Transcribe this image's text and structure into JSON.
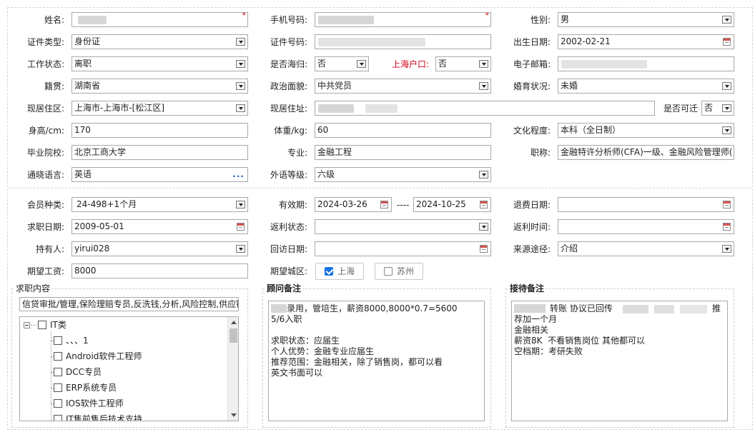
{
  "form": {
    "name_label": "姓名:",
    "phone_label": "手机号码:",
    "gender_label": "性别:",
    "gender_value": "男",
    "id_type_label": "证件类型:",
    "id_type_value": "身份证",
    "id_no_label": "证件号码:",
    "birth_label": "出生日期:",
    "birth_value": "2002-02-21",
    "work_status_label": "工作状态:",
    "work_status_value": "离职",
    "returnee_label": "是否海归:",
    "returnee_value": "否",
    "shanghai_hukou_label": "上海户口:",
    "shanghai_hukou_value": "否",
    "email_label": "电子邮箱:",
    "native_label": "籍贯:",
    "native_value": "湖南省",
    "political_label": "政治面貌:",
    "political_value": "中共党员",
    "marital_label": "婚育状况:",
    "marital_value": "未婚",
    "residence_area_label": "现居住区:",
    "residence_area_value": "上海市-上海市-[松江区]",
    "residence_addr_label": "现居住址:",
    "relocate_label": "是否可迁",
    "relocate_value": "否",
    "height_label": "身高/cm:",
    "height_value": "170",
    "weight_label": "体重/kg:",
    "weight_value": "60",
    "education_label": "文化程度:",
    "education_value": "本科（全日制）",
    "school_label": "毕业院校:",
    "school_value": "北京工商大学",
    "major_label": "专业:",
    "major_value": "金融工程",
    "title_label": "职称:",
    "title_value": "金融特许分析师(CFA)一级、金融风险管理师(",
    "language_label": "通晓语言:",
    "language_value": "英语",
    "language_more": "...",
    "fl_level_label": "外语等级:",
    "fl_level_value": "六级",
    "member_type_label": "会员种类:",
    "member_type_value": "24-498+1个月",
    "validity_label": "有效期:",
    "validity_start": "2024-03-26",
    "validity_sep": "----",
    "validity_end": "2024-10-25",
    "refund_date_label": "退费日期:",
    "job_date_label": "求职日期:",
    "job_date_value": "2009-05-01",
    "rebate_status_label": "返利状态:",
    "rebate_time_label": "返利时间:",
    "holder_label": "持有人:",
    "holder_value": "yirui028",
    "visit_date_label": "回访日期:",
    "source_label": "来源途径:",
    "source_value": "介绍",
    "salary_label": "期望工资:",
    "salary_value": "8000",
    "city_label": "期望城区:",
    "city_shanghai": "上海",
    "city_suzhou": "苏州"
  },
  "job_panel": {
    "legend": "求职内容",
    "summary": "信贷审批/管理,保险理赔专员,反洗钱,分析,风险控制,供应链",
    "tree_root": "IT类",
    "tree_items": [
      "、、、1",
      "Android软件工程师",
      "DCC专员",
      "ERP系统专员",
      "IOS软件工程师",
      "IT售前售后技术支持"
    ]
  },
  "advisor_panel": {
    "legend": "顾问备注",
    "lines": [
      "录用，管培生，薪资8000,8000*0.7=5600",
      "5/6入职",
      "",
      "求职状态：应届生",
      "个人优势：金融专业应届生",
      "推荐范围：金融相关，除了销售岗，都可以看",
      "英文书面可以"
    ]
  },
  "reception_panel": {
    "legend": "接待备注",
    "lines": [
      "转账 协议已回传",
      "荐加一个月",
      "金融相关",
      "薪资8K  不看销售岗位 其他都可以",
      "空档期：考研失败"
    ],
    "line1_tail": "推"
  }
}
